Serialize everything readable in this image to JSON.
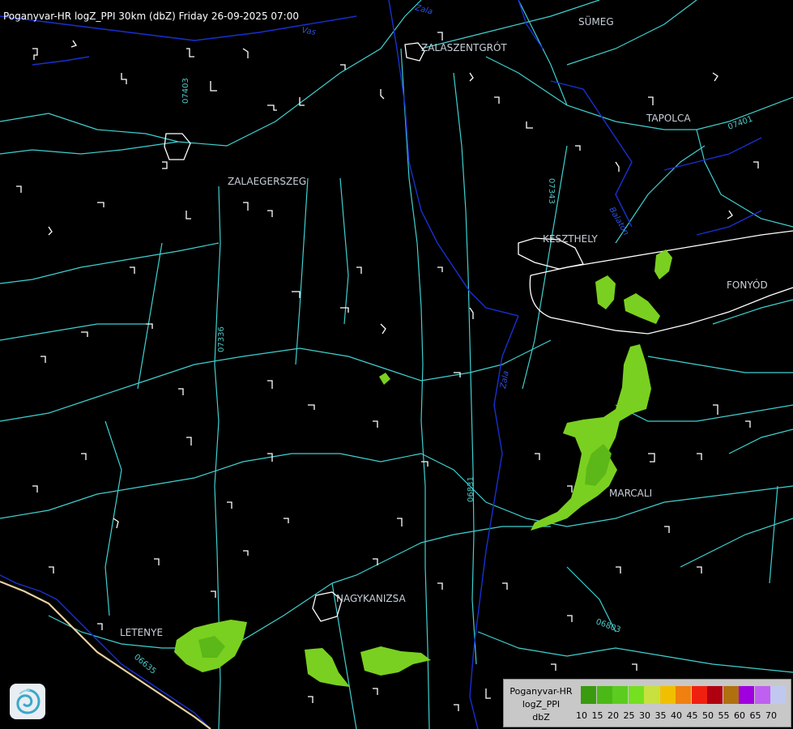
{
  "header": {
    "title": "Poganyvar-HR logZ_PPI 30km (dbZ) Friday 26-09-2025 07:00"
  },
  "cities": [
    {
      "name": "SÜMEG"
    },
    {
      "name": "ZALASZENTGRÓT"
    },
    {
      "name": "TAPOLCA"
    },
    {
      "name": "ZALAEGERSZEG"
    },
    {
      "name": "KESZTHELY"
    },
    {
      "name": "FONYÓD"
    },
    {
      "name": "MARCALI"
    },
    {
      "name": "NAGYKANIZSA"
    },
    {
      "name": "LETENYE"
    }
  ],
  "road_labels": [
    "07403",
    "07343",
    "07401",
    "07336",
    "06831",
    "06803",
    "06635"
  ],
  "river_labels": [
    "Zala",
    "Vas",
    "Zala",
    "Balaton"
  ],
  "legend": {
    "line1": "Poganyvar-HR",
    "line2": "logZ_PPI",
    "line3": "dbZ",
    "ticks": [
      "10",
      "15",
      "20",
      "25",
      "30",
      "35",
      "40",
      "45",
      "50",
      "55",
      "60",
      "65",
      "70"
    ],
    "colors": [
      "#3a9a10",
      "#4cb818",
      "#5ccc20",
      "#74e020",
      "#c8e040",
      "#f0c000",
      "#f08010",
      "#f02010",
      "#b00010",
      "#b07010",
      "#a000e0",
      "#c060f0",
      "#c0c8f0"
    ]
  },
  "colors": {
    "road": "#40d0d0",
    "river": "#1830d0",
    "boundary": "#ffffff",
    "echo_light": "#7ad020",
    "echo_dark": "#5cb818"
  },
  "logo": {
    "icon": "met-service-swirl-icon"
  }
}
